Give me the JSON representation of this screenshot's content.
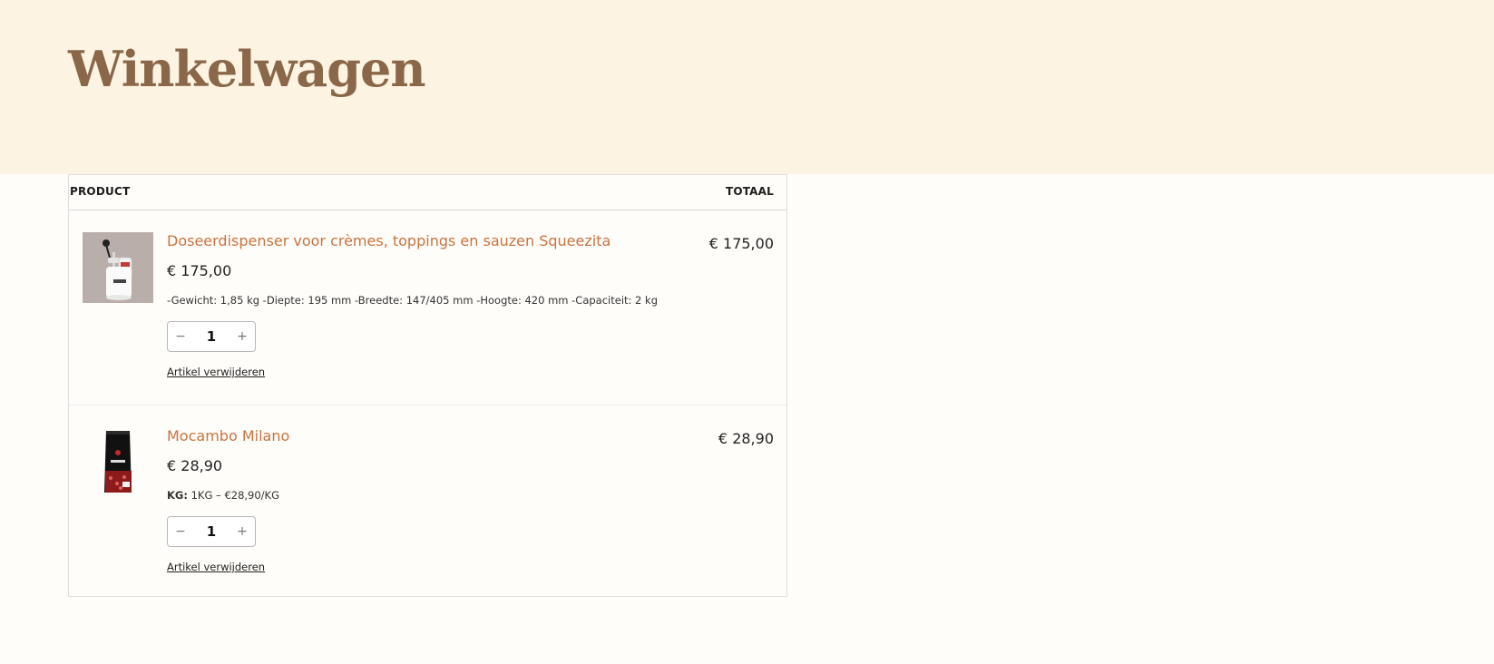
{
  "page": {
    "title": "Winkelwagen"
  },
  "cart": {
    "headers": {
      "product": "PRODUCT",
      "total": "TOTAAL"
    },
    "items": [
      {
        "name": "Doseerdispenser voor crèmes, toppings en sauzen Squeezita",
        "price": "€ 175,00",
        "spec": "-Gewicht: 1,85 kg -Diepte: 195 mm -Breedte: 147/405 mm -Hoogte: 420 mm -Capaciteit: 2 kg",
        "quantity": "1",
        "minus": "−",
        "plus": "+",
        "remove": "Artikel verwijderen",
        "total": "€ 175,00"
      },
      {
        "name": "Mocambo Milano",
        "price": "€ 28,90",
        "spec_label": "KG:",
        "spec_value": " 1KG – €28,90/KG",
        "quantity": "1",
        "minus": "−",
        "plus": "+",
        "remove": "Artikel verwijderen",
        "total": "€ 28,90"
      }
    ]
  },
  "colors": {
    "hero_bg": "#fcf3e3",
    "title": "#8a6749",
    "product_link": "#c8733f"
  }
}
